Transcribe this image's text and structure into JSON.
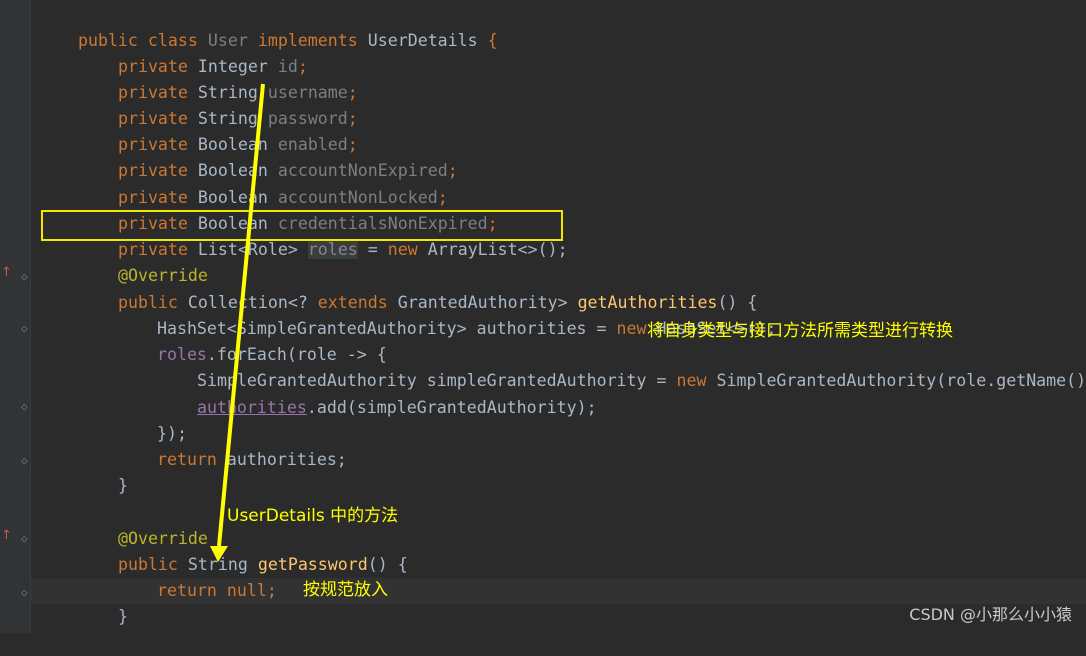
{
  "editor": {
    "lines": [
      [
        "public",
        " ",
        "class",
        " ",
        "User",
        " ",
        "implements",
        " ",
        "UserDetails",
        " {"
      ],
      [
        "private",
        " ",
        "Integer",
        " ",
        "id",
        ";"
      ],
      [
        "private",
        " ",
        "String",
        " ",
        "username",
        ";"
      ],
      [
        "private",
        " ",
        "String",
        " ",
        "password",
        ";"
      ],
      [
        "private",
        " ",
        "Boolean",
        " ",
        "enabled",
        ";"
      ],
      [
        "private",
        " ",
        "Boolean",
        " ",
        "accountNonExpired",
        ";"
      ],
      [
        "private",
        " ",
        "Boolean",
        " ",
        "accountNonLocked",
        ";"
      ],
      [
        "private",
        " ",
        "Boolean",
        " ",
        "credentialsNonExpired",
        ";"
      ],
      [
        "private",
        " ",
        "List<Role>",
        " ",
        "roles",
        " = ",
        "new",
        " ",
        "ArrayList<>();"
      ],
      [
        "@Override"
      ],
      [
        "public",
        " ",
        "Collection<? ",
        "extends",
        " ",
        "GrantedAuthority> ",
        "getAuthorities",
        "() {"
      ],
      [
        "HashSet<SimpleGrantedAuthority> authorities = ",
        "new",
        " HashSet<>();"
      ],
      [
        "roles",
        ".forEach(role -> {"
      ],
      [
        "SimpleGrantedAuthority simpleGrantedAuthority = ",
        "new",
        " SimpleGrantedAuthority(role.getName());"
      ],
      [
        "authorities",
        ".add(simpleGrantedAuthority);"
      ],
      [
        "});"
      ],
      [
        "return",
        " authorities;"
      ],
      [
        "}"
      ],
      [
        ""
      ],
      [
        "@Override"
      ],
      [
        "public",
        " ",
        "String ",
        "getPassword",
        "() {"
      ],
      [
        "return",
        " ",
        "null",
        ";"
      ],
      [
        "}"
      ]
    ]
  },
  "annotations": {
    "note_convert": "将自身类型与接口方法所需类型进行转换",
    "note_userdetails": "UserDetails 中的方法",
    "note_spec": "按规范放入"
  },
  "watermark": "CSDN @小那么小小猿",
  "colors": {
    "background": "#2b2b2b",
    "keyword": "#cc7832",
    "field": "#9876aa",
    "annotation": "#bbb529",
    "method": "#ffc66d",
    "highlight_box": "#f3e600",
    "note_text": "#ffff00"
  }
}
